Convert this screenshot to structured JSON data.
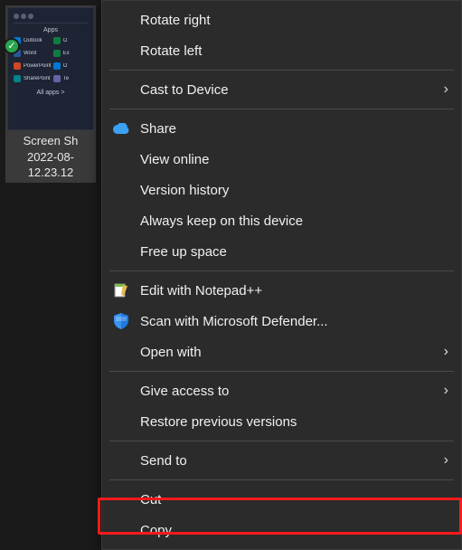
{
  "file": {
    "status_icon": "check-icon",
    "name_line1": "Screen Sh",
    "name_line2": "2022-08-",
    "name_line3": "12.23.12"
  },
  "thumb": {
    "apps_label": "Apps",
    "all_apps_label": "All apps   >",
    "apps": [
      {
        "name": "Outlook",
        "color": "#0078d4"
      },
      {
        "name": "O",
        "color": "#107c41"
      },
      {
        "name": "Word",
        "color": "#2b579a"
      },
      {
        "name": "Ex",
        "color": "#107c41"
      },
      {
        "name": "PowerPoint",
        "color": "#d24726"
      },
      {
        "name": "O",
        "color": "#0078d4"
      },
      {
        "name": "SharePoint",
        "color": "#038387"
      },
      {
        "name": "Te",
        "color": "#6264a7"
      }
    ]
  },
  "menu": {
    "rotate_right": "Rotate right",
    "rotate_left": "Rotate left",
    "cast": "Cast to Device",
    "share": "Share",
    "view_online": "View online",
    "version_history": "Version history",
    "always_keep": "Always keep on this device",
    "free_up": "Free up space",
    "notepad": "Edit with Notepad++",
    "defender": "Scan with Microsoft Defender...",
    "open_with": "Open with",
    "give_access": "Give access to",
    "restore": "Restore previous versions",
    "send_to": "Send to",
    "cut": "Cut",
    "copy": "Copy"
  },
  "colors": {
    "highlight": "#ff1a1a",
    "menu_bg": "#2b2b2b"
  }
}
